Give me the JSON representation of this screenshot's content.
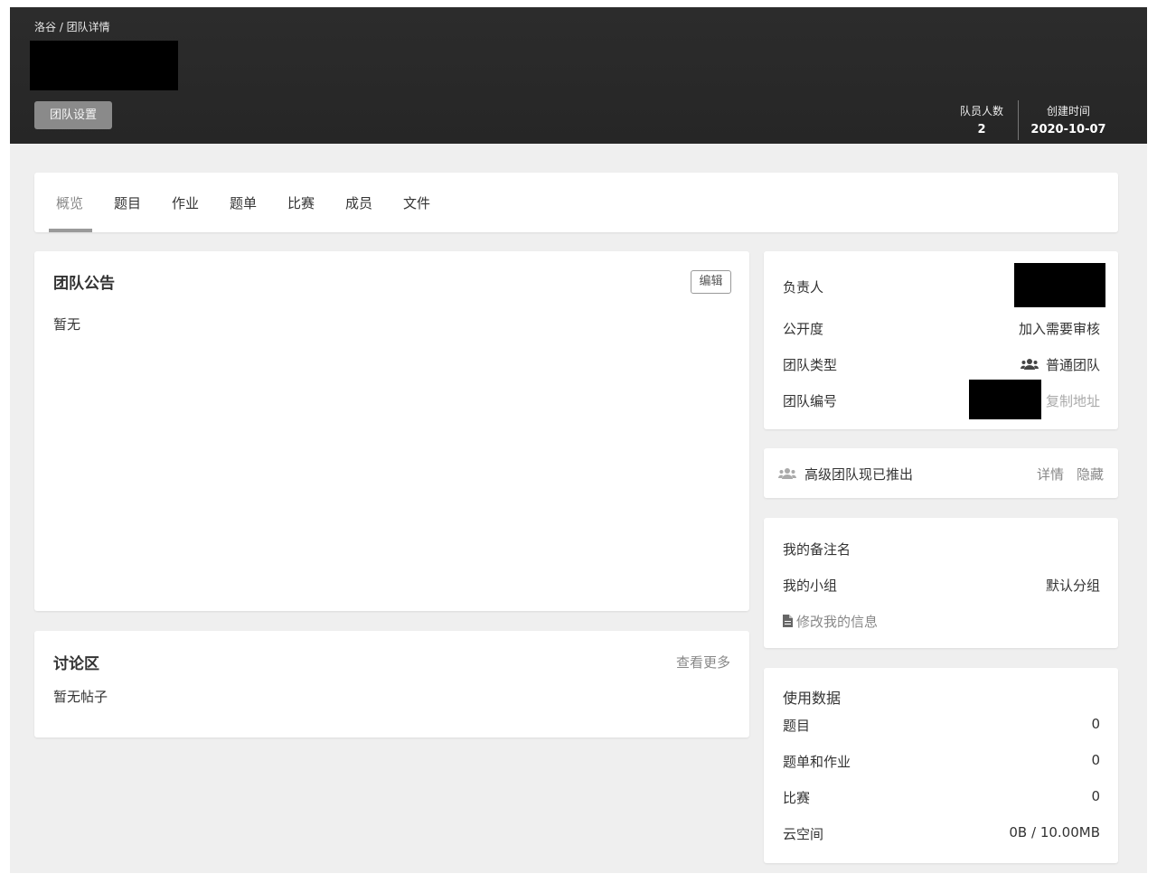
{
  "header": {
    "breadcrumb": "洛谷 / 团队详情",
    "settings_label": "团队设置",
    "stats": [
      {
        "key": "队员人数",
        "value": "2"
      },
      {
        "key": "创建时间",
        "value": "2020-10-07"
      }
    ]
  },
  "tabs": [
    "概览",
    "题目",
    "作业",
    "题单",
    "比赛",
    "成员",
    "文件"
  ],
  "announcement": {
    "title": "团队公告",
    "edit_label": "编辑",
    "content": "暂无"
  },
  "discussion": {
    "title": "讨论区",
    "more_label": "查看更多",
    "content": "暂无帖子"
  },
  "info": {
    "owner_label": "负责人",
    "visibility_label": "公开度",
    "visibility_value": "加入需要审核",
    "type_label": "团队类型",
    "type_value": "普通团队",
    "id_label": "团队编号",
    "copy_label": "复制地址"
  },
  "promo": {
    "text": "高级团队现已推出",
    "details_label": "详情",
    "hide_label": "隐藏"
  },
  "my": {
    "remark_label": "我的备注名",
    "group_label": "我的小组",
    "group_value": "默认分组",
    "edit_label": "修改我的信息"
  },
  "usage": {
    "title": "使用数据",
    "rows": [
      {
        "label": "题目",
        "value": "0"
      },
      {
        "label": "题单和作业",
        "value": "0"
      },
      {
        "label": "比赛",
        "value": "0"
      },
      {
        "label": "云空间",
        "value": "0B / 10.00MB"
      }
    ]
  },
  "colors": {
    "header_bg": "#2a2a2a",
    "page_bg": "#efefef",
    "card_bg": "#ffffff",
    "settings_button": "#8a8a8a"
  },
  "icons": [
    "team-icon",
    "file-icon"
  ]
}
